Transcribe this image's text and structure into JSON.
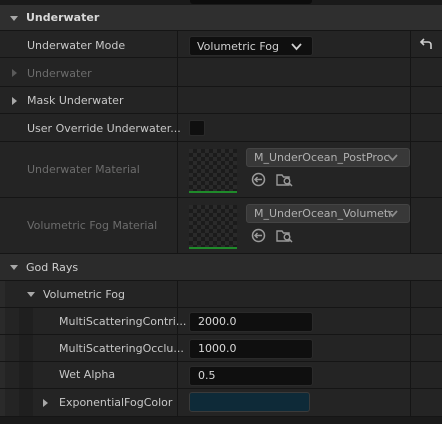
{
  "sections": {
    "underwater": {
      "title": "Underwater",
      "underwater_mode": {
        "label": "Underwater Mode",
        "value": "Volumetric Fog"
      },
      "underwater_group": {
        "label": "Underwater"
      },
      "mask_underwater": {
        "label": "Mask Underwater"
      },
      "user_override": {
        "label": "User Override Underwater..."
      },
      "underwater_material": {
        "label": "Underwater Material",
        "value": "M_UnderOcean_PostProc"
      },
      "volumetric_fog_material": {
        "label": "Volumetric Fog Material",
        "value": "M_UnderOcean_Volumetr"
      }
    },
    "god_rays": {
      "title": "God Rays",
      "volumetric_fog": {
        "title": "Volumetric Fog",
        "multi_scattering_contribution": {
          "label": "MultiScatteringContri...",
          "value": "2000.0"
        },
        "multi_scattering_occlusion": {
          "label": "MultiScatteringOcclu...",
          "value": "1000.0"
        },
        "wet_alpha": {
          "label": "Wet Alpha",
          "value": "0.5"
        },
        "exponential_fog_color": {
          "label": "ExponentialFogColor",
          "color": "#0e2a38"
        }
      }
    }
  },
  "colors": {
    "accent_green": "#1f8a2a",
    "fog_color": "#0e2a38"
  },
  "icons": [
    "reset-arrow-icon",
    "chevron-down-icon",
    "use-selected-icon",
    "browse-icon"
  ]
}
